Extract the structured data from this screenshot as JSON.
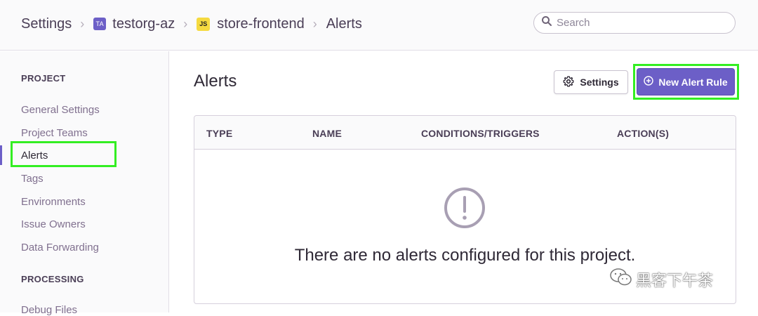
{
  "breadcrumb": {
    "settings": "Settings",
    "org_initials": "TA",
    "org_name": "testorg-az",
    "project_badge": "JS",
    "project_name": "store-frontend",
    "current": "Alerts",
    "separator": "›"
  },
  "search": {
    "placeholder": "Search"
  },
  "sidebar": {
    "project_heading": "PROJECT",
    "items": [
      {
        "label": "General Settings"
      },
      {
        "label": "Project Teams"
      },
      {
        "label": "Alerts",
        "active": true
      },
      {
        "label": "Tags"
      },
      {
        "label": "Environments"
      },
      {
        "label": "Issue Owners"
      },
      {
        "label": "Data Forwarding"
      }
    ],
    "processing_heading": "PROCESSING",
    "processing_items": [
      {
        "label": "Debug Files"
      }
    ]
  },
  "main": {
    "title": "Alerts",
    "settings_button": "Settings",
    "new_rule_button": "New Alert Rule",
    "columns": [
      "TYPE",
      "NAME",
      "CONDITIONS/TRIGGERS",
      "ACTION(S)"
    ],
    "empty_message": "There are no alerts configured for this project."
  },
  "watermark": {
    "text": "黑客下午茶"
  },
  "colors": {
    "accent": "#6c5fc7",
    "highlight": "#33ee22",
    "project_badge": "#f5da40"
  },
  "icons": {
    "search": "search-icon",
    "settings": "gear-icon",
    "new_rule": "circle-plus-icon",
    "empty": "exclamation-circle-icon"
  }
}
